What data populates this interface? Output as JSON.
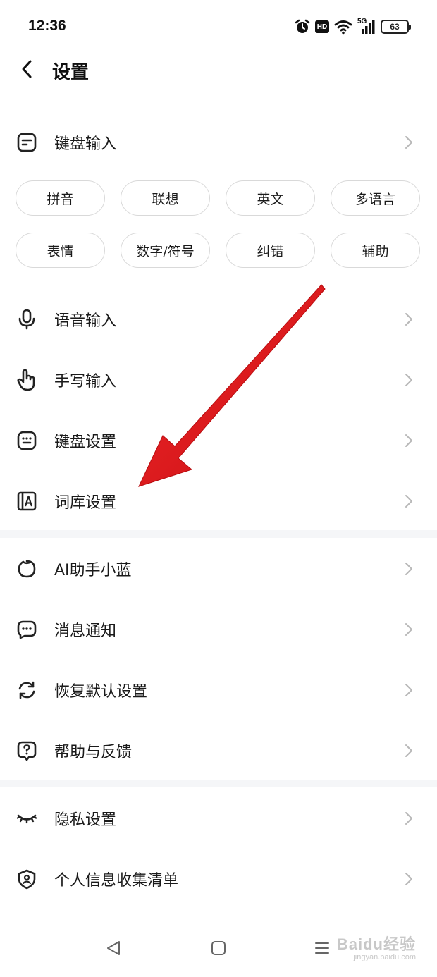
{
  "status_bar": {
    "time": "12:36",
    "hd_label": "HD",
    "network_label": "5G",
    "battery": "63"
  },
  "header": {
    "back_icon": "chevron-left-icon",
    "title": "设置"
  },
  "keyboard_input": {
    "label": "键盘输入",
    "icon": "keyboard-input-icon",
    "chips": [
      "拼音",
      "联想",
      "英文",
      "多语言",
      "表情",
      "数字/符号",
      "纠错",
      "辅助"
    ]
  },
  "menu_group_1": [
    {
      "label": "语音输入",
      "icon": "microphone-icon"
    },
    {
      "label": "手写输入",
      "icon": "hand-pointer-icon"
    },
    {
      "label": "键盘设置",
      "icon": "keyboard-settings-icon"
    },
    {
      "label": "词库设置",
      "icon": "dictionary-icon"
    }
  ],
  "menu_group_2": [
    {
      "label": "AI助手小蓝",
      "icon": "ai-assistant-icon"
    },
    {
      "label": "消息通知",
      "icon": "message-icon"
    },
    {
      "label": "恢复默认设置",
      "icon": "refresh-icon"
    },
    {
      "label": "帮助与反馈",
      "icon": "help-icon"
    }
  ],
  "menu_group_3": [
    {
      "label": "隐私设置",
      "icon": "closed-eye-icon"
    },
    {
      "label": "个人信息收集清单",
      "icon": "shield-user-icon"
    }
  ],
  "watermark": {
    "main": "Baidu经验",
    "sub": "jingyan.baidu.com"
  },
  "colors": {
    "annotation_arrow": "#e8191c",
    "divider": "#f5f6f8",
    "chip_border": "#d9d9d9",
    "chevron": "#b8b8b8"
  }
}
